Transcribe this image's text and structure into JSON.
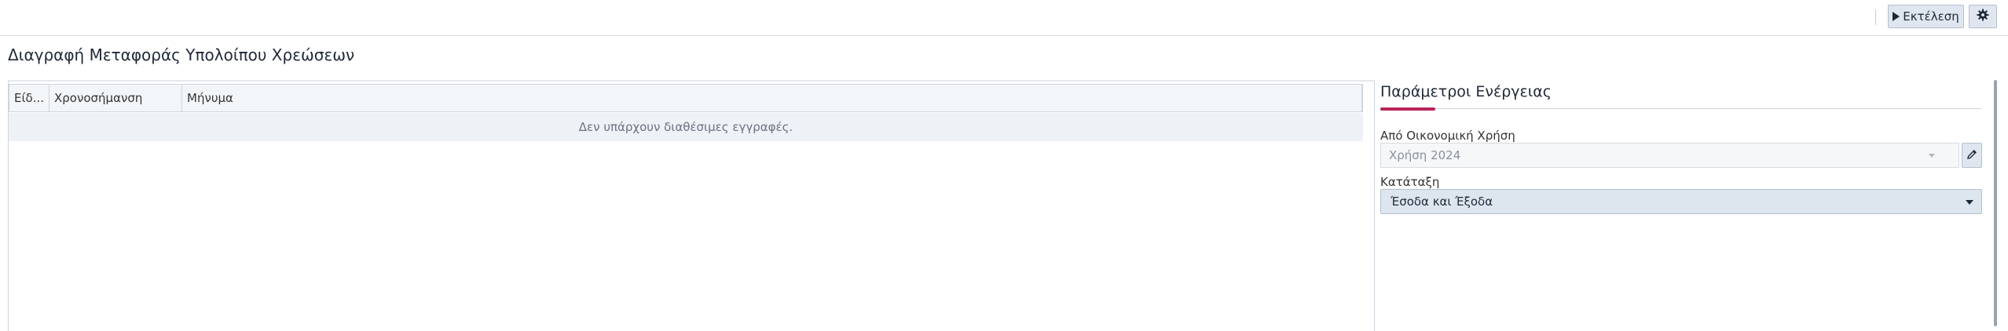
{
  "toolbar": {
    "run_label": "Εκτέλεση",
    "run_icon": "play-icon",
    "settings_icon": "gear-icon"
  },
  "page": {
    "title": "Διαγραφή Μεταφοράς Υπολοίπου Χρεώσεων"
  },
  "grid": {
    "columns": [
      "Είδ...",
      "Χρονοσήμανση",
      "Μήνυμα"
    ],
    "empty_message": "Δεν υπάρχουν διαθέσιμες εγγραφές."
  },
  "params": {
    "title": "Παράμετροι Ενέργειας",
    "fiscal_year": {
      "label": "Από Οικονομική Χρήση",
      "value": "Χρήση 2024",
      "edit_icon": "pencil-icon"
    },
    "classification": {
      "label": "Κατάταξη",
      "value": "Έσοδα και Έξοδα"
    }
  },
  "colors": {
    "accent": "#b8245a",
    "button_bg": "#dfe6ef",
    "header_bg": "#f3f6f9",
    "empty_row_bg": "#eef1f5"
  }
}
